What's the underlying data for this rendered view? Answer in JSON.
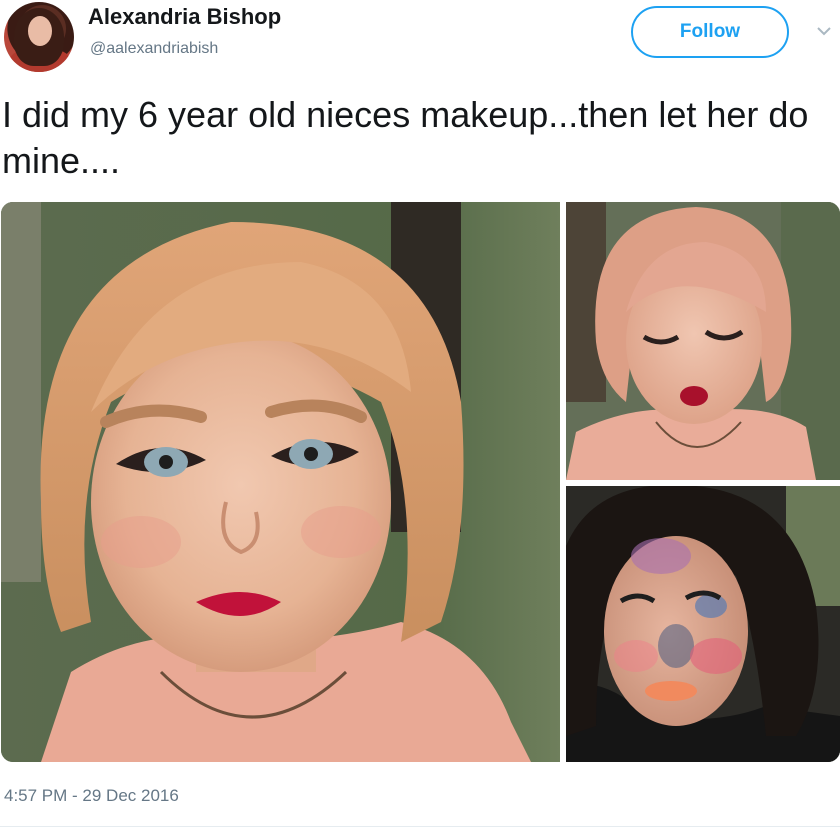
{
  "author": {
    "name": "Alexandria Bishop",
    "handle": "@aalexandriabish"
  },
  "follow_label": "Follow",
  "tweet_text": "I did my 6 year old nieces makeup...then let her do mine....",
  "timestamp": "4:57 PM - 29 Dec 2016",
  "colors": {
    "accent": "#1da1f2",
    "text": "#14171a",
    "secondary_text": "#657786"
  },
  "icons": {
    "menu": "chevron-down-icon"
  }
}
